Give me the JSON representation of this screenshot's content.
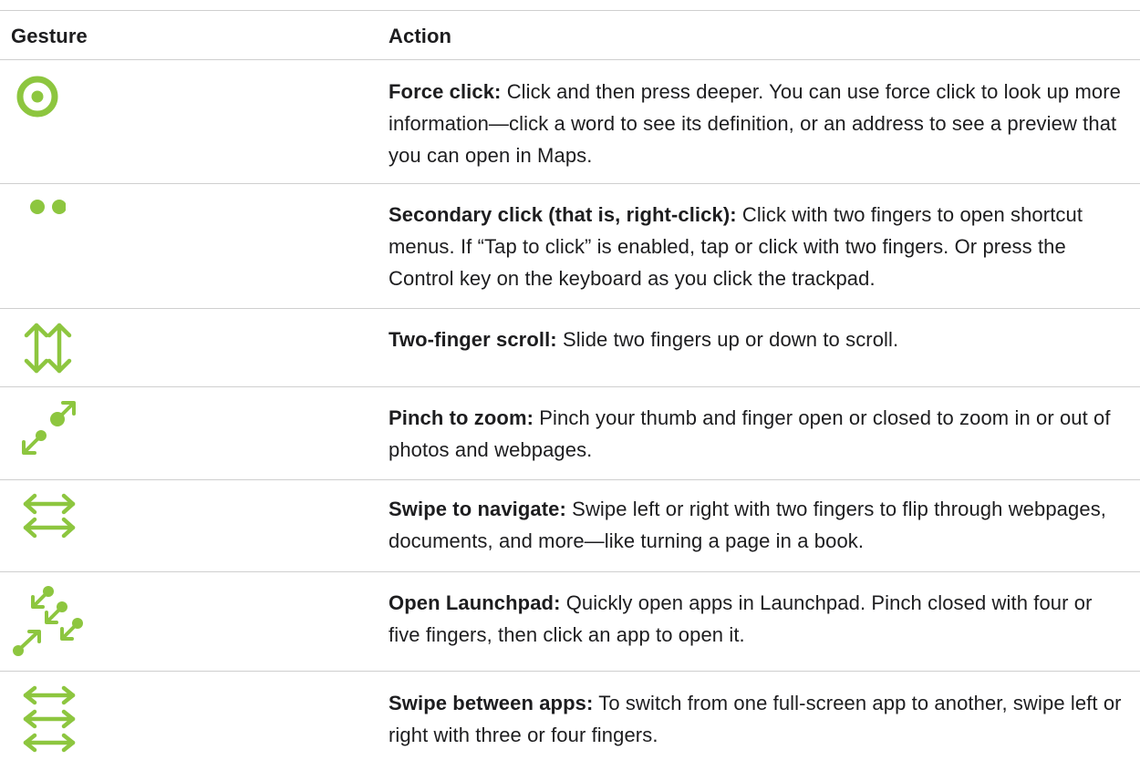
{
  "header": {
    "gesture": "Gesture",
    "action": "Action"
  },
  "accent_color": "#8dc63f",
  "rows": [
    {
      "icon": "force-click-icon",
      "term": "Force click:",
      "description": " Click and then press deeper. You can use force click to look up more information—click a word to see its definition, or an address to see a preview that you can open in Maps."
    },
    {
      "icon": "secondary-click-icon",
      "term": "Secondary click (that is, right-click):",
      "description": " Click with two fingers to open shortcut menus. If “Tap to click” is enabled, tap or click with two fingers. Or press the Control key on the keyboard as you click the trackpad."
    },
    {
      "icon": "two-finger-scroll-icon",
      "term": "Two-finger scroll:",
      "description": " Slide two fingers up or down to scroll."
    },
    {
      "icon": "pinch-zoom-icon",
      "term": "Pinch to zoom:",
      "description": " Pinch your thumb and finger open or closed to zoom in or out of photos and webpages."
    },
    {
      "icon": "swipe-navigate-icon",
      "term": "Swipe to navigate:",
      "description": " Swipe left or right with two fingers to flip through webpages, documents, and more—like turning a page in a book."
    },
    {
      "icon": "launchpad-icon",
      "term": "Open Launchpad:",
      "description": " Quickly open apps in Launchpad. Pinch closed with four or five fingers, then click an app to open it."
    },
    {
      "icon": "swipe-apps-icon",
      "term": "Swipe between apps:",
      "description": " To switch from one full-screen app to another, swipe left or right with three or four fingers."
    }
  ]
}
